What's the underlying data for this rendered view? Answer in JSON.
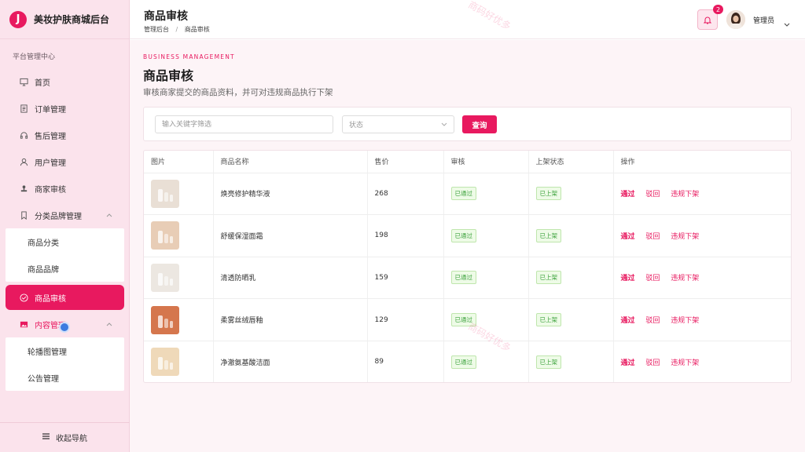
{
  "brand": {
    "logo_letter": "J",
    "title": "美妆护肤商城后台"
  },
  "sidebar": {
    "section_title": "平台管理中心",
    "items": [
      {
        "label": "首页",
        "icon": "monitor-icon"
      },
      {
        "label": "订单管理",
        "icon": "document-icon"
      },
      {
        "label": "售后管理",
        "icon": "headset-icon"
      },
      {
        "label": "用户管理",
        "icon": "user-icon"
      },
      {
        "label": "商家审核",
        "icon": "stamp-icon"
      },
      {
        "label": "分类品牌管理",
        "icon": "bookmark-icon",
        "expanded": true
      },
      {
        "label": "商品审核",
        "icon": "check-circle-icon",
        "active": true
      },
      {
        "label": "内容管理",
        "icon": "image-icon",
        "expanded": true
      }
    ],
    "category_sub": [
      "商品分类",
      "商品品牌"
    ],
    "content_sub": [
      "轮播图管理",
      "公告管理"
    ],
    "collapse_label": "收起导航"
  },
  "header": {
    "title": "商品审核",
    "breadcrumb": [
      "管理后台",
      "商品审核"
    ],
    "breadcrumb_sep": "/",
    "notification_count": "2",
    "user_name": "管理员"
  },
  "main": {
    "eyebrow": "BUSINESS MANAGEMENT",
    "title": "商品审核",
    "description": "审核商家提交的商品资料，并可对违规商品执行下架",
    "filter": {
      "search_placeholder": "输入关键字筛选",
      "status_placeholder": "状态",
      "query_label": "查询"
    },
    "table": {
      "columns": [
        "图片",
        "商品名称",
        "售价",
        "审核",
        "上架状态",
        "操作"
      ],
      "rows": [
        {
          "name": "焕亮修护精华液",
          "price": "268",
          "audit": "已通过",
          "shelf": "已上架",
          "thumb_color": "#e9dfd5"
        },
        {
          "name": "舒缓保湿面霜",
          "price": "198",
          "audit": "已通过",
          "shelf": "已上架",
          "thumb_color": "#e8cdb6"
        },
        {
          "name": "清透防晒乳",
          "price": "159",
          "audit": "已通过",
          "shelf": "已上架",
          "thumb_color": "#ece7e1"
        },
        {
          "name": "柔雾丝绒唇釉",
          "price": "129",
          "audit": "已通过",
          "shelf": "已上架",
          "thumb_color": "#d5764d"
        },
        {
          "name": "净澈氨基酸洁面",
          "price": "89",
          "audit": "已通过",
          "shelf": "已上架",
          "thumb_color": "#efd9b9"
        }
      ],
      "actions": {
        "pass": "通过",
        "reject": "驳回",
        "takedown": "违规下架"
      }
    }
  },
  "watermark": "商码好优多",
  "colors": {
    "accent": "#e8195f",
    "sidebar_bg": "#fbe3ec",
    "main_bg": "#fdf4f7",
    "tag_green": "#3ca23c"
  }
}
